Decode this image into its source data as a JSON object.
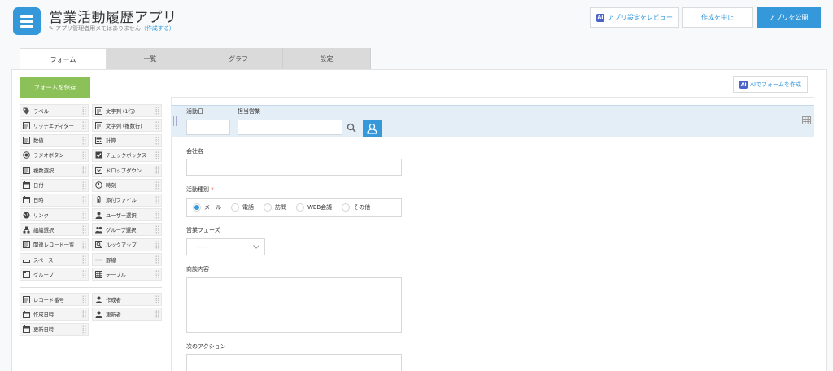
{
  "header": {
    "title": "営業活動履歴アプリ",
    "memo": "アプリ管理者用メモはありません",
    "memo_link": "（作成する）",
    "review_label": "アプリ設定をレビュー",
    "cancel_label": "作成を中止",
    "publish_label": "アプリを公開",
    "ai_badge": "AI"
  },
  "tabs": [
    {
      "label": "フォーム"
    },
    {
      "label": "一覧"
    },
    {
      "label": "グラフ"
    },
    {
      "label": "設定"
    }
  ],
  "toolbar": {
    "save_label": "フォームを保存",
    "ai_form_label": "AIでフォームを作成"
  },
  "palette": [
    {
      "label": "ラベル",
      "icon": "tag-icon"
    },
    {
      "label": "文字列 (1行)",
      "icon": "text-line-icon"
    },
    {
      "label": "リッチエディター",
      "icon": "rich-editor-icon"
    },
    {
      "label": "文字列 (複数行)",
      "icon": "text-multiline-icon"
    },
    {
      "label": "数値",
      "icon": "number-icon"
    },
    {
      "label": "計算",
      "icon": "calculator-icon"
    },
    {
      "label": "ラジオボタン",
      "icon": "radio-icon"
    },
    {
      "label": "チェックボックス",
      "icon": "checkbox-icon"
    },
    {
      "label": "複数選択",
      "icon": "multi-select-icon"
    },
    {
      "label": "ドロップダウン",
      "icon": "dropdown-icon"
    },
    {
      "label": "日付",
      "icon": "calendar-icon"
    },
    {
      "label": "時刻",
      "icon": "clock-icon"
    },
    {
      "label": "日時",
      "icon": "datetime-icon"
    },
    {
      "label": "添付ファイル",
      "icon": "paperclip-icon"
    },
    {
      "label": "リンク",
      "icon": "globe-icon"
    },
    {
      "label": "ユーザー選択",
      "icon": "user-icon"
    },
    {
      "label": "組織選択",
      "icon": "org-icon"
    },
    {
      "label": "グループ選択",
      "icon": "group-icon"
    },
    {
      "label": "関連レコード一覧",
      "icon": "related-records-icon"
    },
    {
      "label": "ルックアップ",
      "icon": "lookup-icon"
    },
    {
      "label": "スペース",
      "icon": "space-icon"
    },
    {
      "label": "罫線",
      "icon": "line-icon"
    },
    {
      "label": "グループ",
      "icon": "folder-icon"
    },
    {
      "label": "テーブル",
      "icon": "table-icon"
    }
  ],
  "system_fields": [
    {
      "label": "レコード番号",
      "icon": "record-number-icon"
    },
    {
      "label": "作成者",
      "icon": "user-icon"
    },
    {
      "label": "作成日時",
      "icon": "datetime-icon"
    },
    {
      "label": "更新者",
      "icon": "user-icon"
    },
    {
      "label": "更新日時",
      "icon": "datetime-icon"
    }
  ],
  "form": {
    "activity_date_label": "活動日",
    "sales_rep_label": "担当営業",
    "company_label": "会社名",
    "activity_type_label": "活動種別",
    "required_mark": "*",
    "activity_types": [
      "メール",
      "電話",
      "訪問",
      "WEB会議",
      "その他"
    ],
    "selected_activity_type": "メール",
    "phase_label": "営業フェーズ",
    "phase_value": "-----",
    "discussion_label": "商談内容",
    "next_action_label": "次のアクション"
  }
}
